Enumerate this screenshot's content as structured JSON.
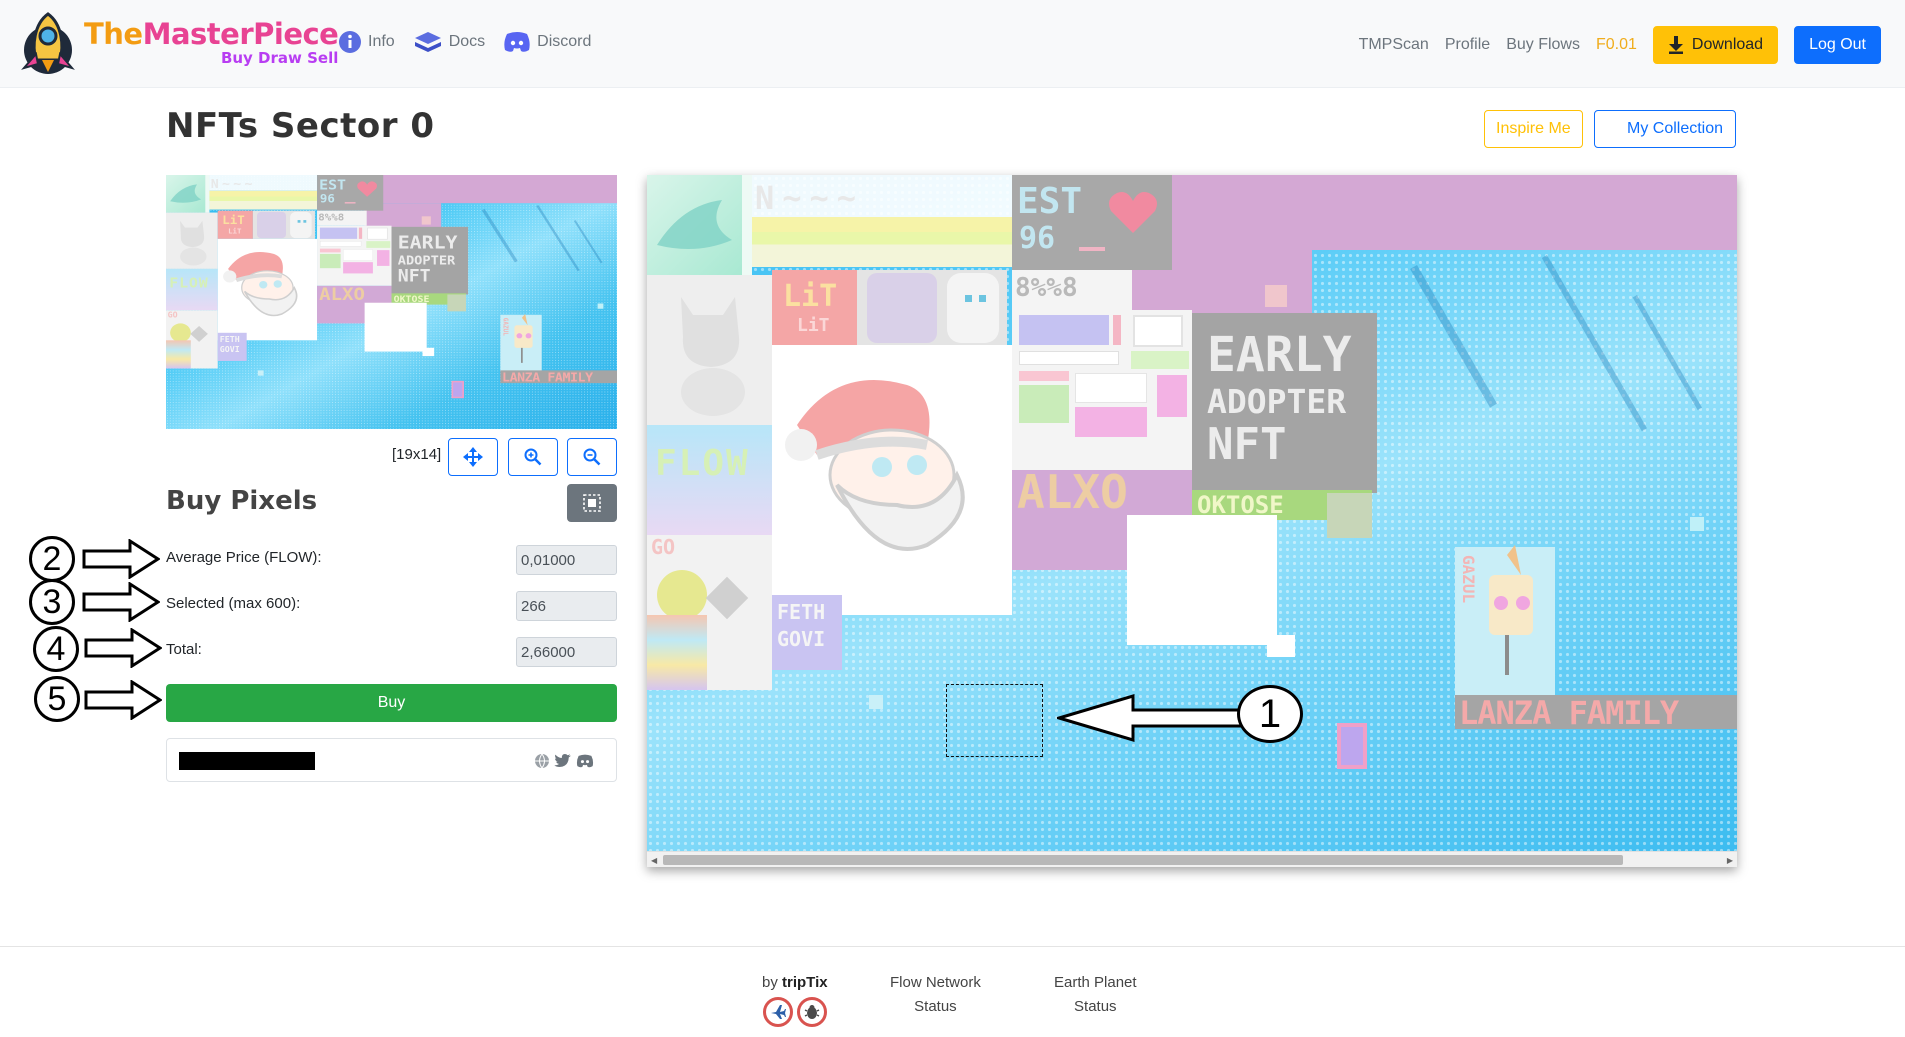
{
  "brand": {
    "name_part1": "The",
    "name_part2": "MasterPiece",
    "tagline": "Buy Draw Sell"
  },
  "nav": {
    "left": [
      {
        "label": "Info",
        "icon": "info-icon"
      },
      {
        "label": "Docs",
        "icon": "book-icon"
      },
      {
        "label": "Discord",
        "icon": "discord-icon"
      }
    ],
    "right": [
      "TMPScan",
      "Profile",
      "Buy Flows"
    ],
    "balance": "F0.01",
    "download_label": "Download",
    "logout_label": "Log Out"
  },
  "page": {
    "title": "NFTs Sector 0",
    "inspire_label": "Inspire Me",
    "collection_label": "My Collection"
  },
  "minimap": {
    "size_label": "[19x14]"
  },
  "buy": {
    "title": "Buy Pixels",
    "avg_price_label": "Average Price (FLOW):",
    "avg_price_value": "0,01000",
    "selected_label": "Selected (max 600):",
    "selected_value": "266",
    "total_label": "Total:",
    "total_value": "2,66000",
    "buy_label": "Buy"
  },
  "annotations": [
    "1",
    "2",
    "3",
    "4",
    "5"
  ],
  "canvas_art": {
    "est": "EST",
    "est_year": "96",
    "early": "EARLY",
    "adopter": "ADOPTER",
    "nft": "NFT",
    "lit": "LiT",
    "lit2": "LiT",
    "flow": "FLOW",
    "alxo": "ALXO",
    "oktose": "OKTOSE",
    "feth": "FETH",
    "govi": "GOVI",
    "lanza": "LANZA FAMILY",
    "gazul": "GAZUL"
  },
  "footer": {
    "by_label": "by",
    "by_name": "tripTix",
    "flow_status": [
      "Flow Network",
      "Status"
    ],
    "earth_status": [
      "Earth Planet",
      "Status"
    ]
  },
  "colors": {
    "primary": "#0d6efd",
    "warning": "#ffc107",
    "success": "#28a745",
    "secondary": "#6c757d"
  }
}
